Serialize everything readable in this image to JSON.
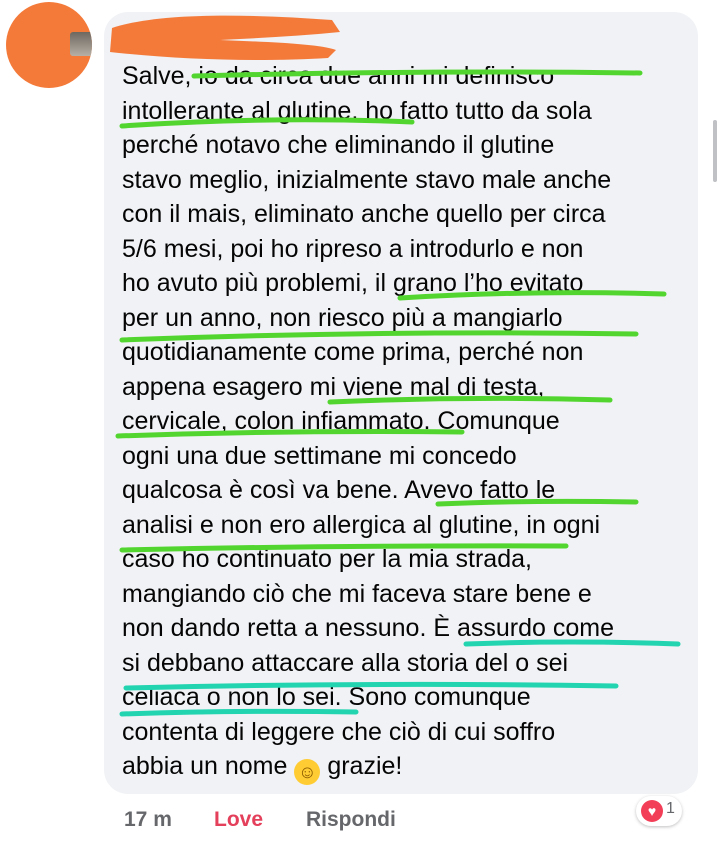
{
  "comment": {
    "lines": [
      "Salve, io da circa due anni mi definisco",
      "intollerante al glutine, ho fatto tutto da sola",
      "perché notavo che eliminando il glutine",
      "stavo meglio, inizialmente stavo male anche",
      "con il mais, eliminato anche quello per circa",
      "5/6 mesi, poi ho ripreso a introdurlo e non",
      "ho avuto più problemi, il grano l’ho evitato",
      "per un anno, non riesco più a mangiarlo",
      "quotidianamente come prima, perché non",
      "appena esagero mi viene mal di testa,",
      "cervicale, colon infiammato. Comunque",
      "ogni una due settimane mi concedo",
      "qualcosa è così va bene. Avevo fatto le",
      "analisi e non ero allergica al glutine, in ogni",
      "caso ho continuato per la mia strada,",
      "mangiando ciò che mi faceva stare bene e",
      "non dando retta a nessuno. È assurdo come",
      "si debbano attaccare alla storia del o sei",
      "celiaca o non lo sei. Sono comunque",
      "contenta di leggere che ciò di cui soffro"
    ],
    "last_line_before": "abbia un nome",
    "last_line_after": "grazie!",
    "emoji": "smiling-face-emoji"
  },
  "actions": {
    "time": "17 m",
    "love": "Love",
    "reply": "Rispondi"
  },
  "reaction": {
    "count": "1",
    "icon": "heart-icon"
  },
  "colors": {
    "avatar_redaction": "#f47a3a",
    "green_highlight": "#52d62f",
    "teal_highlight": "#22d4b0",
    "love": "#e4405b",
    "bubble": "#f0f2f5"
  }
}
